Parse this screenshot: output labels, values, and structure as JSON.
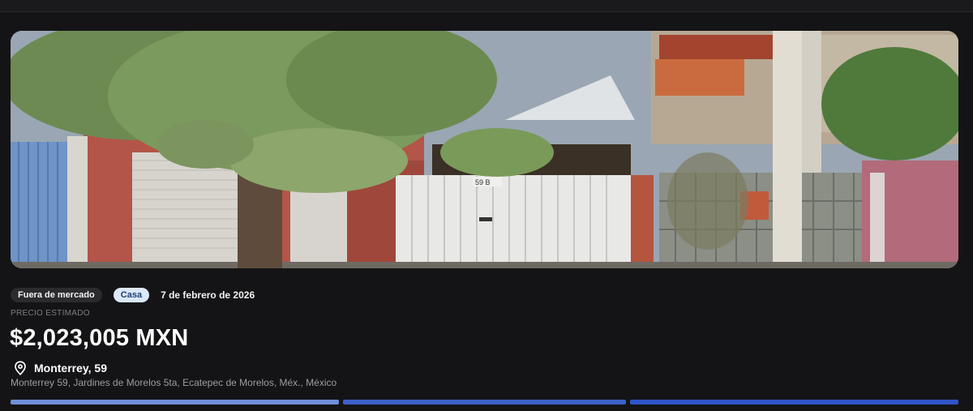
{
  "listing": {
    "status_badge": "Fuera de mercado",
    "type_badge": "Casa",
    "date": "7 de febrero de 2026",
    "price_label": "PRECIO ESTIMADO",
    "price": "$2,023,005 MXN",
    "location_title": "Monterrey, 59",
    "address": "Monterrey 59, Jardines de Morelos 5ta, Ecatepec de Morelos, Méx., México",
    "house_number_plate": "59 B"
  },
  "icons": {
    "location": "map-pin-icon"
  },
  "colors": {
    "background": "#141416",
    "status_badge_bg": "#2b2b2e",
    "type_badge_bg": "#dbe7fb",
    "type_badge_text": "#1f3f78",
    "bar_active": "#6f8fd8",
    "bar_mid": "#3d61c9",
    "bar_end": "#2f55c8"
  },
  "gallery": {
    "segments": 3,
    "active_index": 0
  }
}
